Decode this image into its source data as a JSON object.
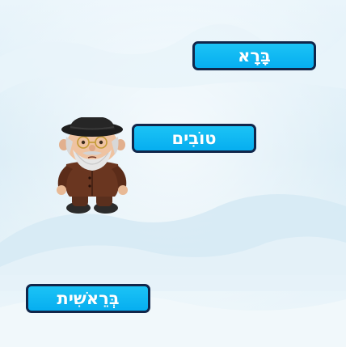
{
  "game": {
    "word_buttons": [
      {
        "label": "בָּרָא"
      },
      {
        "label": "טוֹבִים"
      },
      {
        "label": "בְּרֵאשִׁית"
      }
    ],
    "character": {
      "icon": "rabbi-character-icon"
    }
  },
  "colors": {
    "button_fill": "#06aef0",
    "button_border": "#11264a",
    "background": "#dfeff7"
  }
}
